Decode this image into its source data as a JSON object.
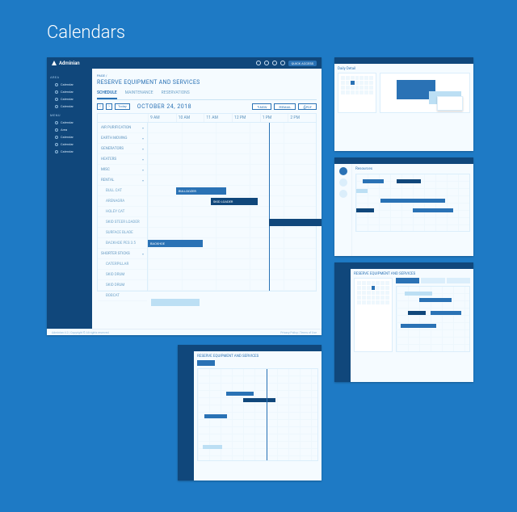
{
  "page": {
    "title": "Calendars"
  },
  "brand": "Adminian",
  "header": {
    "pill": "QUICK ACCESS"
  },
  "sidebar": {
    "section1": "AREA",
    "section2": "MENU",
    "items1": [
      "Calendar",
      "Calendar",
      "Calendar",
      "Calendar"
    ],
    "items2": [
      "Calendar",
      "Area",
      "Calendar",
      "Calendar",
      "Calendar"
    ]
  },
  "crumb": "PAGE /",
  "page_h": "RESERVE EQUIPMENT AND SERVICES",
  "tabs": {
    "t0": "SCHEDULE",
    "t1": "MAINTENANCE",
    "t2": "RESERVATIONS"
  },
  "toolbar": {
    "prev": "‹",
    "next": "›",
    "today": "Today",
    "date": "OCTOBER 24, 2018",
    "a0": "NEW",
    "a1": "EMAIL",
    "a2": "PDF"
  },
  "hours": {
    "h0": "9 AM",
    "h1": "10 AM",
    "h2": "11 AM",
    "h3": "12 PM",
    "h4": "1 PM",
    "h5": "2 PM"
  },
  "resources": {
    "r0": "AIR PURIFICATION",
    "r1": "EARTH MOVING",
    "r2": "GENERATORS",
    "r3": "HEATERS",
    "r4": "MISC",
    "r5": "RENTAL",
    "r6": "BULL CAT",
    "r7": "ARENAGRA",
    "r8": "HOLEY CAT",
    "r9": "SKID STEER LOADER",
    "r10": "SURFACE BLADE",
    "r11": "BACKHOE PES 3.5",
    "r12": "SHORTER STICKS",
    "r13": "CATERPILLAR",
    "r14": "SKID DRUM",
    "r15": "SKID DRUM",
    "r16": "BOBCAT"
  },
  "bars": {
    "b0": "BULLDOZER",
    "b1": "SKID LOADER",
    "b2": "BACKHOE"
  },
  "footer": {
    "left": "Adminian 4.2  |  Copyright © All rights reserved",
    "right": "Privacy Policy  |  Terms of Use"
  },
  "thumbs": {
    "t1": "Daily Detail",
    "t2": "Resources",
    "t3": "RESERVE EQUIPMENT AND SERVICES",
    "b": "RESERVE EQUIPMENT AND SERVICES"
  }
}
